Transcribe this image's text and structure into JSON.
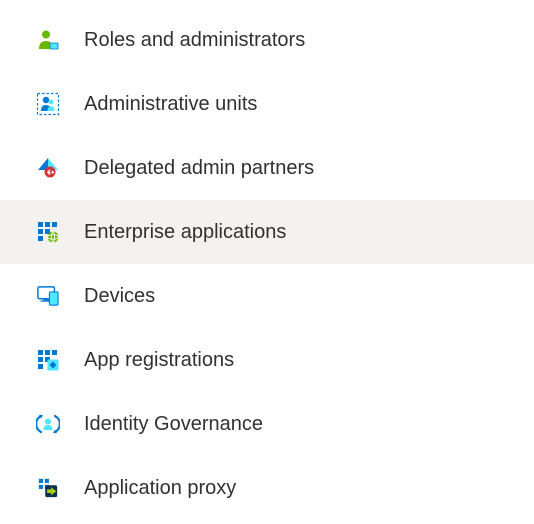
{
  "nav": {
    "items": [
      {
        "label": "Roles and administrators",
        "icon": "roles-admin-icon",
        "selected": false
      },
      {
        "label": "Administrative units",
        "icon": "admin-units-icon",
        "selected": false
      },
      {
        "label": "Delegated admin partners",
        "icon": "delegated-partners-icon",
        "selected": false
      },
      {
        "label": "Enterprise applications",
        "icon": "enterprise-apps-icon",
        "selected": true
      },
      {
        "label": "Devices",
        "icon": "devices-icon",
        "selected": false
      },
      {
        "label": "App registrations",
        "icon": "app-registrations-icon",
        "selected": false
      },
      {
        "label": "Identity Governance",
        "icon": "identity-governance-icon",
        "selected": false
      },
      {
        "label": "Application proxy",
        "icon": "application-proxy-icon",
        "selected": false
      }
    ]
  },
  "colors": {
    "azureBlue": "#0078d4",
    "green": "#6bb700",
    "red": "#d13438",
    "text": "#323130",
    "hover": "#f3f2f1"
  }
}
